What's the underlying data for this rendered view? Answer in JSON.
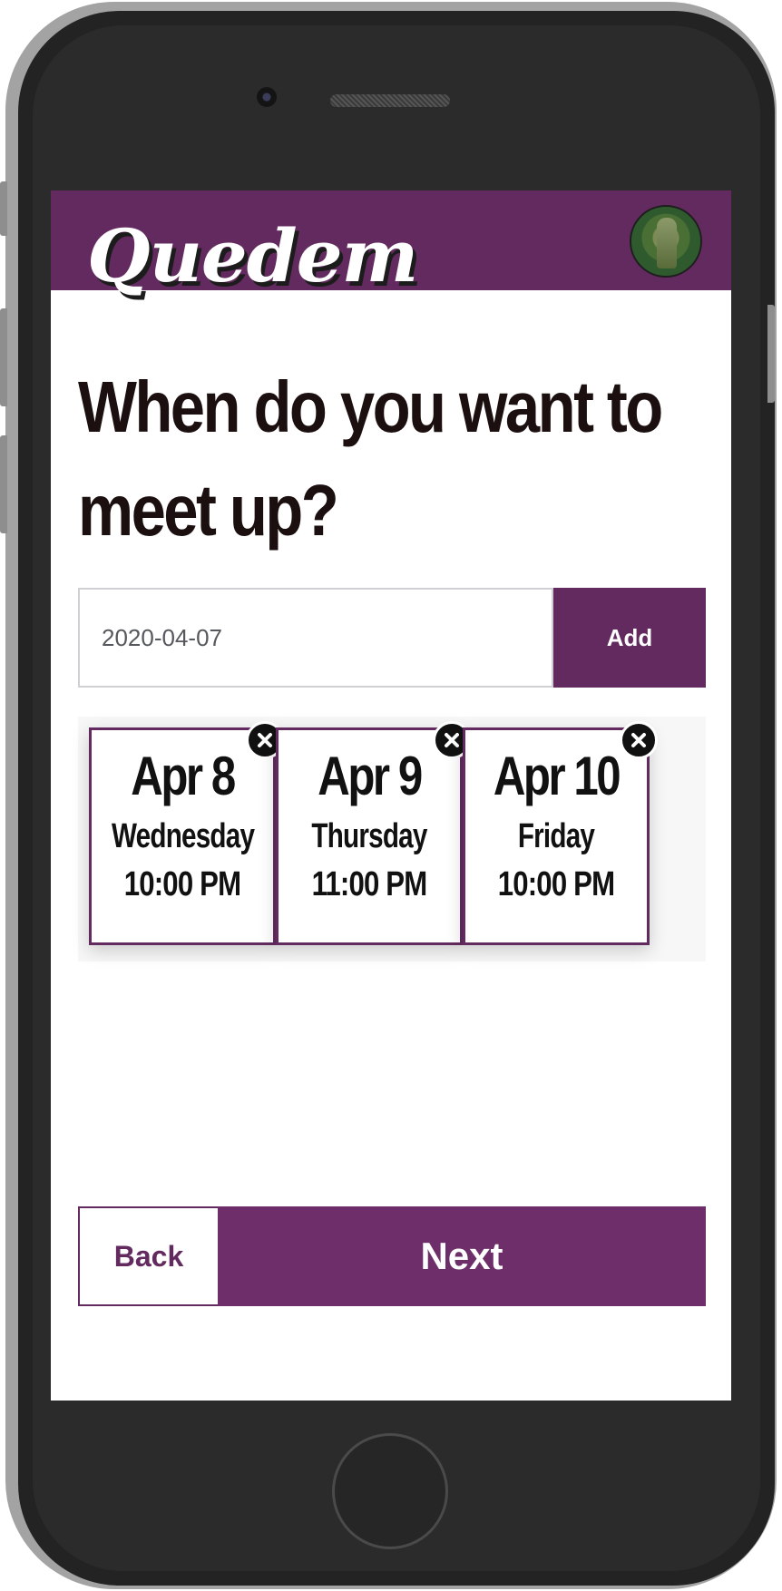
{
  "app": {
    "name": "Quedem",
    "accent_color": "#632a60",
    "avatar_icon": "profile-photo"
  },
  "page": {
    "headline": "When do you want to meet up?"
  },
  "date_picker": {
    "value": "2020-04-07",
    "add_label": "Add"
  },
  "meetup_options": [
    {
      "date": "Apr 8",
      "weekday": "Wednesday",
      "time": "10:00 PM",
      "remove_icon": "close-icon"
    },
    {
      "date": "Apr 9",
      "weekday": "Thursday",
      "time": "11:00 PM",
      "remove_icon": "close-icon"
    },
    {
      "date": "Apr 10",
      "weekday": "Friday",
      "time": "10:00 PM",
      "remove_icon": "close-icon"
    }
  ],
  "navigation": {
    "back_label": "Back",
    "next_label": "Next"
  }
}
